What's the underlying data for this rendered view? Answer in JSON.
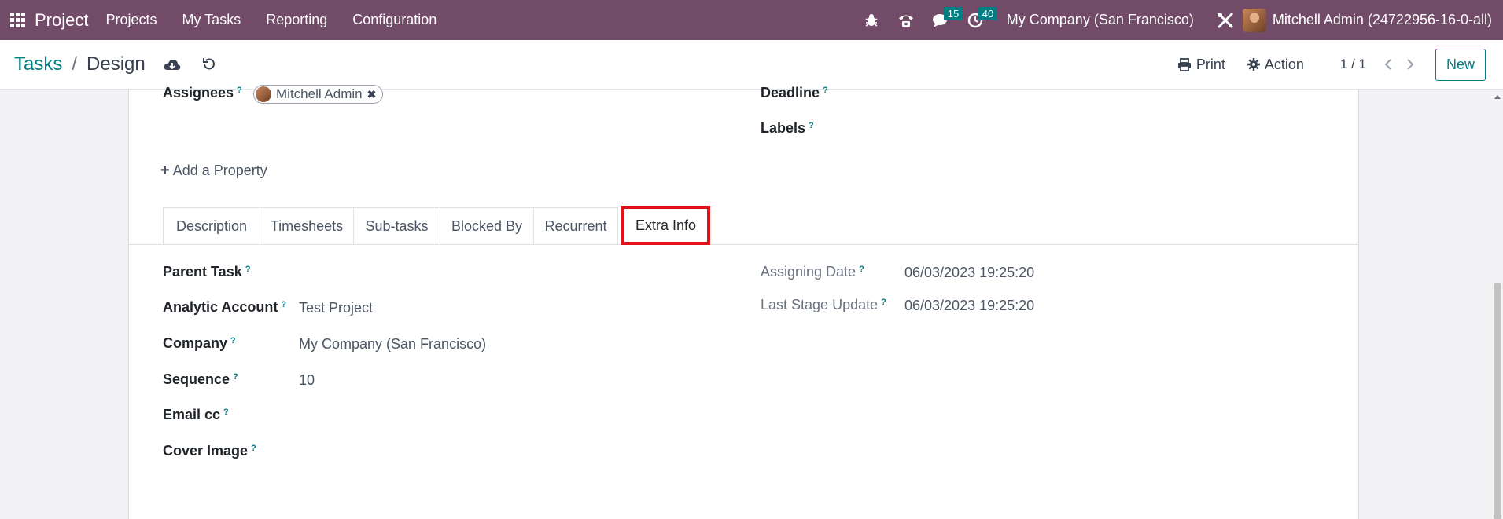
{
  "navbar": {
    "app_name": "Project",
    "menu": [
      "Projects",
      "My Tasks",
      "Reporting",
      "Configuration"
    ],
    "chat_badge": "15",
    "activity_badge": "40",
    "company": "My Company (San Francisco)",
    "user": "Mitchell Admin (24722956-16-0-all)",
    "icons": [
      "apps-grid-icon",
      "bug-icon",
      "phone-icon",
      "chat-icon",
      "clock-icon",
      "tools-icon"
    ]
  },
  "control": {
    "breadcrumb_parent": "Tasks",
    "breadcrumb_sep": "/",
    "breadcrumb_current": "Design",
    "print_label": "Print",
    "action_label": "Action",
    "pager": "1 / 1",
    "new_label": "New"
  },
  "form": {
    "assignees_label": "Assignees",
    "assignee_name": "Mitchell Admin",
    "deadline_label": "Deadline",
    "labels_label": "Labels",
    "add_property": "Add a Property",
    "help_mark": "?"
  },
  "tabs": [
    "Description",
    "Timesheets",
    "Sub-tasks",
    "Blocked By",
    "Recurrent",
    "Extra Info"
  ],
  "active_tab": "Extra Info",
  "extra_info": {
    "left": [
      {
        "label": "Parent Task",
        "value": ""
      },
      {
        "label": "Analytic Account",
        "value": "Test Project"
      },
      {
        "label": "Company",
        "value": "My Company (San Francisco)"
      },
      {
        "label": "Sequence",
        "value": "10"
      },
      {
        "label": "Email cc",
        "value": ""
      },
      {
        "label": "Cover Image",
        "value": ""
      }
    ],
    "right": [
      {
        "label": "Assigning Date",
        "value": "06/03/2023 19:25:20"
      },
      {
        "label": "Last Stage Update",
        "value": "06/03/2023 19:25:20"
      }
    ]
  },
  "colors": {
    "navbar": "#714b67",
    "accent": "#017e84",
    "highlight": "#e5101a"
  }
}
